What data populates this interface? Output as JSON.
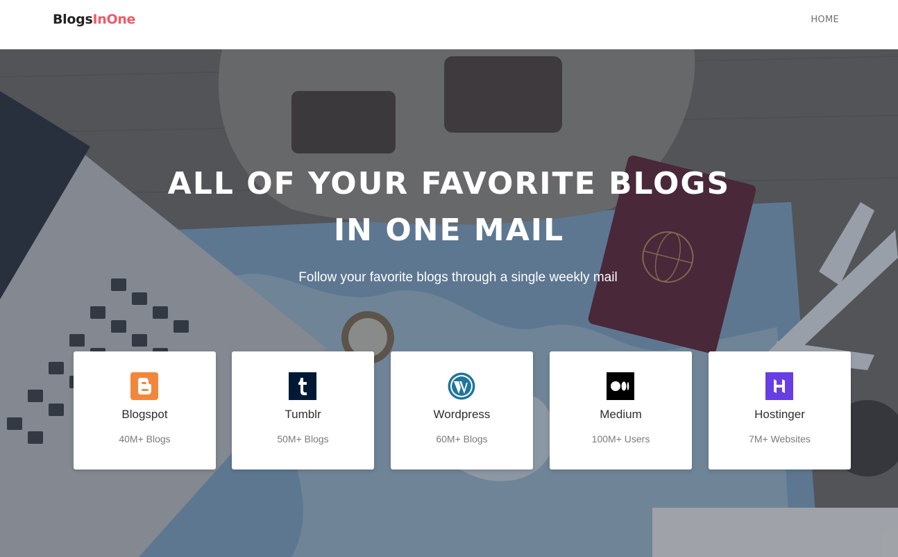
{
  "navbar": {
    "brand_part1": "Blogs",
    "brand_part2": "InOne",
    "home_label": "HOME"
  },
  "hero": {
    "title_line1": "ALL OF YOUR FAVORITE BLOGS",
    "title_line2": "IN ONE MAIL",
    "subtitle": "Follow your favorite blogs through a single weekly mail"
  },
  "cards": [
    {
      "name": "Blogspot",
      "stat": "40M+ Blogs",
      "icon": "blogger-icon",
      "color": "#f1873b"
    },
    {
      "name": "Tumblr",
      "stat": "50M+ Blogs",
      "icon": "tumblr-icon",
      "color": "#001935"
    },
    {
      "name": "Wordpress",
      "stat": "60M+ Blogs",
      "icon": "wordpress-icon",
      "color": "#21759b"
    },
    {
      "name": "Medium",
      "stat": "100M+ Users",
      "icon": "medium-icon",
      "color": "#000000"
    },
    {
      "name": "Hostinger",
      "stat": "7M+ Websites",
      "icon": "hostinger-icon",
      "color": "#673de6"
    }
  ],
  "colors": {
    "brand_accent": "#ee5a67",
    "brand_dark": "#222222"
  }
}
